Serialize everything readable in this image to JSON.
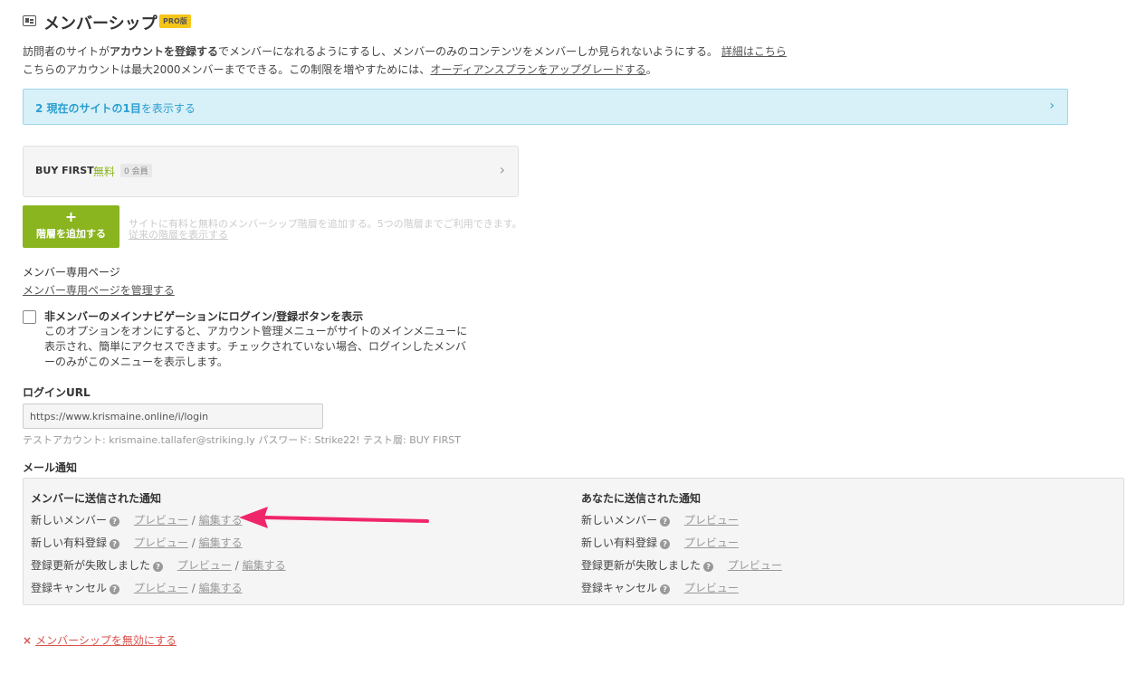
{
  "header": {
    "title": "メンバーシップ",
    "badge": "PRO版",
    "icon": "membership-card-icon"
  },
  "description": {
    "line1_prefix": "訪問者のサイトが",
    "line1_bold": "アカウントを登録する",
    "line1_suffix": "でメンバーになれるようにするし、メンバーのみのコンテンツをメンバーしか見られないようにする。",
    "line1_link": "詳細はこちら",
    "line2_text": "こちらのアカウントは最大2000メンバーまでできる。この制限を増やすためには、",
    "line2_link": "オーディアンスプランをアップグレードする",
    "line2_end": "。"
  },
  "info_banner": {
    "bold": "2 現在のサイトの1目",
    "text": "を表示する"
  },
  "tier": {
    "name": "BUY FIRST",
    "price": "無料",
    "count": "0 会員"
  },
  "add_tier": {
    "plus": "+",
    "label": "階層を追加する",
    "hint": "サイトに有料と無料のメンバーシップ階層を追加する。5つの階層までご利用できます。",
    "old_link": "従来の階層を表示する"
  },
  "member_pages": {
    "heading": "メンバー専用ページ",
    "link": "メンバー専用ページを管理する"
  },
  "nav_option": {
    "label": "非メンバーのメインナビゲーションにログイン/登録ボタンを表示",
    "desc": "このオプションをオンにすると、アカウント管理メニューがサイトのメインメニューに表示され、簡単にアクセスできます。チェックされていない場合、ログインしたメンバーのみがこのメニューを表示します。",
    "checked": false
  },
  "login": {
    "heading": "ログインURL",
    "url": "https://www.krismaine.online/i/login",
    "test_account": "テストアカウント: krismaine.tallafer@striking.ly パスワード: Strike22! テスト層: BUY FIRST"
  },
  "email": {
    "heading": "メール通知",
    "member_col": {
      "heading": "メンバーに送信された通知",
      "rows": [
        {
          "label": "新しいメンバー",
          "preview": "プレビュー",
          "edit": "編集する"
        },
        {
          "label": "新しい有料登録",
          "preview": "プレビュー",
          "edit": "編集する"
        },
        {
          "label": "登録更新が失敗しました",
          "preview": "プレビュー",
          "edit": "編集する"
        },
        {
          "label": "登録キャンセル",
          "preview": "プレビュー",
          "edit": "編集する"
        }
      ]
    },
    "owner_col": {
      "heading": "あなたに送信された通知",
      "rows": [
        {
          "label": "新しいメンバー",
          "preview": "プレビュー"
        },
        {
          "label": "新しい有料登録",
          "preview": "プレビュー"
        },
        {
          "label": "登録更新が失敗しました",
          "preview": "プレビュー"
        },
        {
          "label": "登録キャンセル",
          "preview": "プレビュー"
        }
      ]
    },
    "separator": "/",
    "help_glyph": "?"
  },
  "disable": {
    "icon": "×",
    "link": "メンバーシップを無効にする"
  },
  "colors": {
    "accent_green": "#8ab51e",
    "info_blue": "#2a9fd0",
    "danger_red": "#d9534f",
    "arrow_pink": "#f0266a",
    "badge_yellow": "#f5c518"
  }
}
